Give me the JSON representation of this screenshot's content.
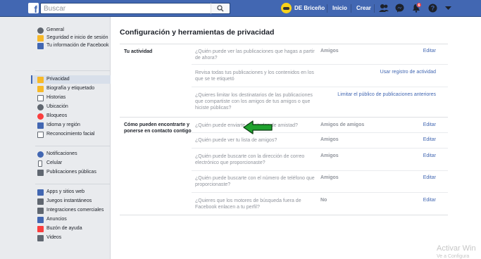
{
  "header": {
    "logo": "f",
    "search_placeholder": "Buscar",
    "user_name": "DE Briceño",
    "nav": [
      "Inicio",
      "Crear"
    ],
    "notification_count": "6"
  },
  "sidebar": {
    "group1": [
      {
        "label": "General",
        "icon": "gear-icon",
        "color": "#606770"
      },
      {
        "label": "Seguridad e inicio de sesión",
        "icon": "badge-icon",
        "color": "#f7b928"
      },
      {
        "label": "Tu información de Facebook",
        "icon": "facebook-icon",
        "color": "#4267b2"
      }
    ],
    "group2": [
      {
        "label": "Privacidad",
        "icon": "lock-icon",
        "color": "#f7b928",
        "active": true
      },
      {
        "label": "Biografía y etiquetado",
        "icon": "biography-icon",
        "color": "#f7b928"
      },
      {
        "label": "Historias",
        "icon": "book-icon",
        "color": "#606770"
      },
      {
        "label": "Ubicación",
        "icon": "location-icon",
        "color": "#606770"
      },
      {
        "label": "Bloqueos",
        "icon": "block-icon",
        "color": "#fa3e3e"
      },
      {
        "label": "Idioma y región",
        "icon": "language-icon",
        "color": "#4267b2"
      },
      {
        "label": "Reconocimiento facial",
        "icon": "face-icon",
        "color": "#606770"
      }
    ],
    "group3": [
      {
        "label": "Notificaciones",
        "icon": "globe-icon",
        "color": "#4267b2"
      },
      {
        "label": "Celular",
        "icon": "mobile-icon",
        "color": "#606770"
      },
      {
        "label": "Publicaciones públicas",
        "icon": "rss-icon",
        "color": "#606770"
      }
    ],
    "group4": [
      {
        "label": "Apps y sitios web",
        "icon": "apps-icon",
        "color": "#4267b2"
      },
      {
        "label": "Juegos instantáneos",
        "icon": "games-icon",
        "color": "#606770"
      },
      {
        "label": "Integraciones comerciales",
        "icon": "integrations-icon",
        "color": "#606770"
      },
      {
        "label": "Anuncios",
        "icon": "ads-icon",
        "color": "#4267b2"
      },
      {
        "label": "Buzón de ayuda",
        "icon": "help-inbox-icon",
        "color": "#fa3e3e"
      },
      {
        "label": "Videos",
        "icon": "video-icon",
        "color": "#606770"
      }
    ]
  },
  "page_title": "Configuración y herramientas de privacidad",
  "sections": [
    {
      "title": "Tu actividad",
      "rows": [
        {
          "question": "¿Quién puede ver las publicaciones que hagas a partir de ahora?",
          "value": "Amigos",
          "action": "Editar"
        },
        {
          "question": "Revisa todas tus publicaciones y los contenidos en los que se te etiquetó",
          "value": "",
          "action": "Usar registro de actividad"
        },
        {
          "question": "¿Quieres limitar los destinatarios de las publicaciones que compartiste con los amigos de tus amigos o que hiciste públicas?",
          "value": "",
          "action": "Limitar el público de publicaciones anteriores"
        }
      ]
    },
    {
      "title": "Cómo pueden encontrarte y ponerse en contacto contigo",
      "rows": [
        {
          "question": "¿Quién puede enviarte solicitudes de amistad?",
          "value": "Amigos de amigos",
          "action": "Editar"
        },
        {
          "question": "¿Quién puede ver tu lista de amigos?",
          "value": "Amigos",
          "action": "Editar"
        },
        {
          "question": "¿Quién puede buscarte con la dirección de correo electrónico que proporcionaste?",
          "value": "Amigos",
          "action": "Editar"
        },
        {
          "question": "¿Quién puede buscarte con el número de teléfono que proporcionaste?",
          "value": "Amigos",
          "action": "Editar"
        },
        {
          "question": "¿Quieres que los motores de búsqueda fuera de Facebook enlacen a tu perfil?",
          "value": "No",
          "action": "Editar"
        }
      ]
    }
  ],
  "annotation": {
    "icon": "green-arrow-icon",
    "color": "#1fa22e"
  },
  "watermark": {
    "line1": "Activar Win",
    "line2": "Ve a Configura"
  }
}
